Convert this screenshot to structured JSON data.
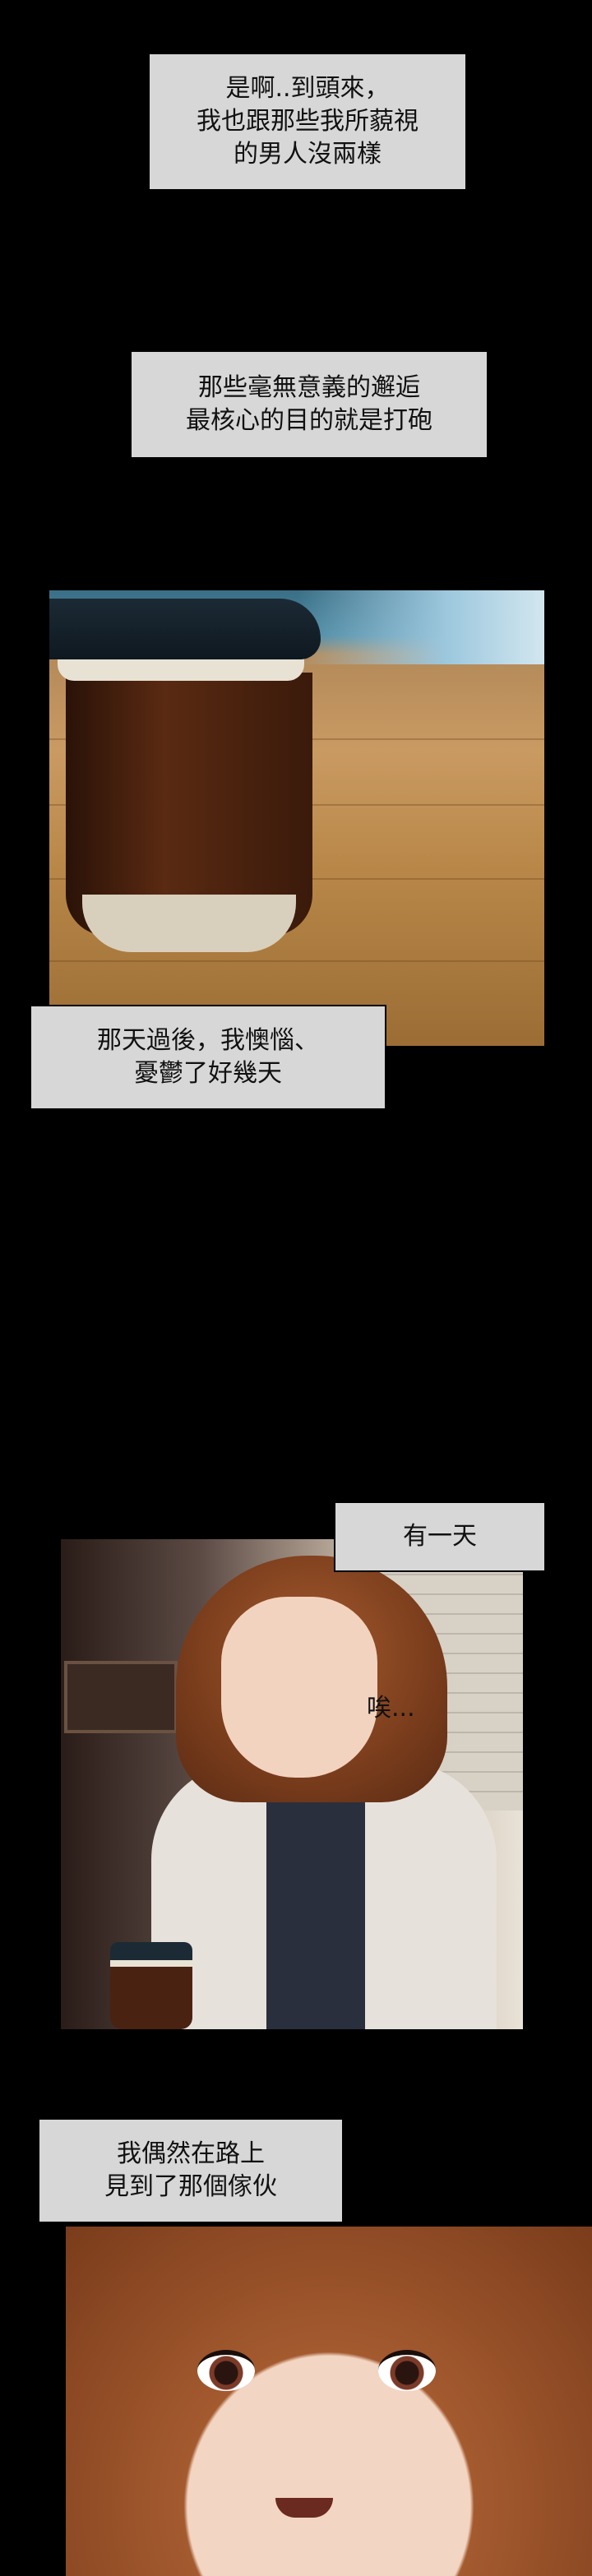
{
  "captions": {
    "c1": [
      "是啊..到頭來，",
      "我也跟那些我所藐視",
      "的男人沒兩樣"
    ],
    "c2": [
      "那些毫無意義的邂逅",
      "最核心的目的就是打砲"
    ],
    "c3": [
      "那天過後，我懊惱、",
      "憂鬱了好幾天"
    ],
    "c4": [
      "有一天"
    ],
    "c5": [
      "我偶然在路上",
      "見到了那個傢伙"
    ]
  },
  "sfx": {
    "sigh": "唉..."
  },
  "colors": {
    "background": "#000000",
    "caption_box": "#d7d7d7",
    "caption_text": "#111111"
  }
}
